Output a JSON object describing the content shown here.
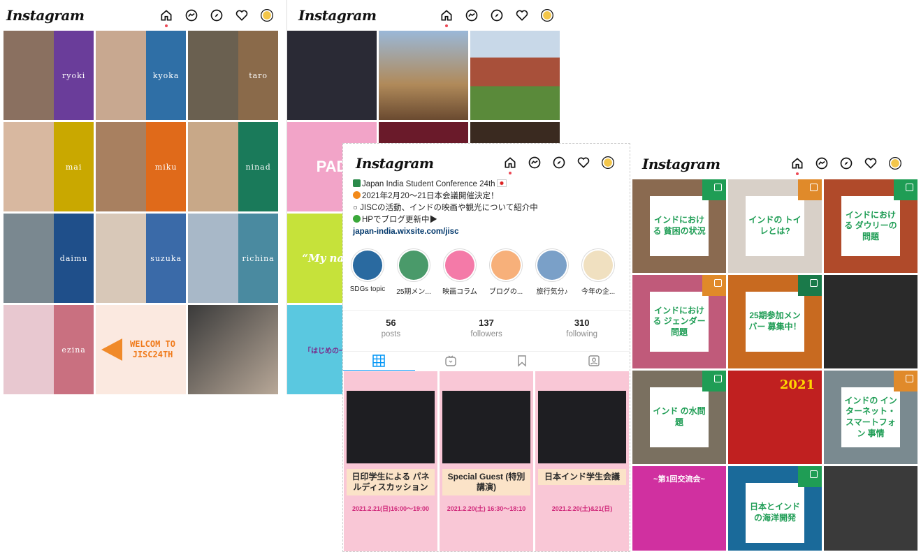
{
  "app": {
    "logo": "Instagram"
  },
  "nav_icons": [
    "home-icon",
    "messenger-icon",
    "explore-icon",
    "heart-icon",
    "avatar"
  ],
  "colors": {
    "notify_dot": "#ed4956",
    "link": "#00376b",
    "tab_active": "#0095f6",
    "insta_green": "#1f9d55"
  },
  "panel1": {
    "tiles": [
      {
        "name": "ryoki",
        "color": "#6a3d9a"
      },
      {
        "name": "kyoka",
        "color": "#2f6fa6"
      },
      {
        "name": "taro",
        "color": "#8a6a4a"
      },
      {
        "name": "mai",
        "color": "#c9a800"
      },
      {
        "name": "miku",
        "color": "#e06a1a"
      },
      {
        "name": "ninad",
        "color": "#1a7a5a"
      },
      {
        "name": "daimu",
        "color": "#1f4f8a"
      },
      {
        "name": "suzuka",
        "color": "#3a6aa8"
      },
      {
        "name": "richina",
        "color": "#4a8aa0"
      },
      {
        "name": "ezina",
        "color": "#c97080"
      }
    ],
    "welcome": {
      "line1": "WELCOM TO",
      "line2": "JISC24TH"
    }
  },
  "panel2": {
    "side_labels": [
      "PAD",
      "“My name",
      "「はじめの一歩へ"
    ]
  },
  "panel3": {
    "bio": {
      "line1": "Japan India Student Conference 24th",
      "line2": "2021年2月20〜21日本会議開催決定！",
      "line3": "○ JISCの活動、インドの映画や観光について紹介中",
      "line4": "HPでブログ更新中▶",
      "link": "japan-india.wixsite.com/jisc"
    },
    "highlights": [
      {
        "label": "SDGs topic",
        "color": "#2a6aa0"
      },
      {
        "label": "25期メン...",
        "color": "#4a9a6a"
      },
      {
        "label": "映画コラム",
        "color": "#f47aa8"
      },
      {
        "label": "ブログの...",
        "color": "#f7b07a"
      },
      {
        "label": "旅行気分♪",
        "color": "#7aa0c8"
      },
      {
        "label": "今年の企...",
        "color": "#f0e0c0"
      }
    ],
    "stats": [
      {
        "value": "56",
        "label": "posts"
      },
      {
        "value": "137",
        "label": "followers"
      },
      {
        "value": "310",
        "label": "following"
      }
    ],
    "tabs": [
      "grid-icon",
      "igtv-icon",
      "saved-icon",
      "tagged-icon"
    ],
    "posts": [
      {
        "title": "日印学生による パネルディスカッション",
        "date": "2021.2.21(日)16:00〜19:00",
        "bg": "#fbe3c8"
      },
      {
        "title": "Special Guest (特別講演)",
        "date": "2021.2.20(土) 16:30〜18:10",
        "bg": "#fbe3c8"
      },
      {
        "title": "日本インド学生会議",
        "date": "2021.2.20(土)&21(日)",
        "bg": "#fbe3c8"
      }
    ]
  },
  "panel4": {
    "tiles": [
      {
        "text": "インドにおける 貧困の状況",
        "bg": "#8a6a50",
        "corner": "#1f9d55"
      },
      {
        "text": "インドの トイレとは?",
        "bg": "#d8d0c8",
        "corner": "#e08a2a"
      },
      {
        "text": "インドにおける ダウリーの問題",
        "bg": "#b04a2a",
        "corner": "#1f9d55"
      },
      {
        "text": "インドにおける ジェンダー問題",
        "bg": "#c05a7a",
        "corner": "#e08a2a"
      },
      {
        "text": "25期参加メンバー 募集中！",
        "bg": "#c86a20",
        "corner": "#1a7a4a"
      },
      {
        "text": "",
        "bg": "#2a2a2a",
        "corner": ""
      },
      {
        "text": "インド の水問題",
        "bg": "#7a7060",
        "corner": "#1f9d55"
      },
      {
        "text": "2021",
        "bg": "#c02020",
        "corner": ""
      },
      {
        "text": "インドの インターネット・ スマートフォン 事情",
        "bg": "#7a8a90",
        "corner": "#e08a2a"
      },
      {
        "text": "~第1回交流会~",
        "bg": "#d030a0",
        "corner": ""
      },
      {
        "text": "日本とインド の海洋開発",
        "bg": "#1a6a9a",
        "corner": "#1f9d55"
      },
      {
        "text": "",
        "bg": "#3a3a3a",
        "corner": ""
      }
    ]
  }
}
